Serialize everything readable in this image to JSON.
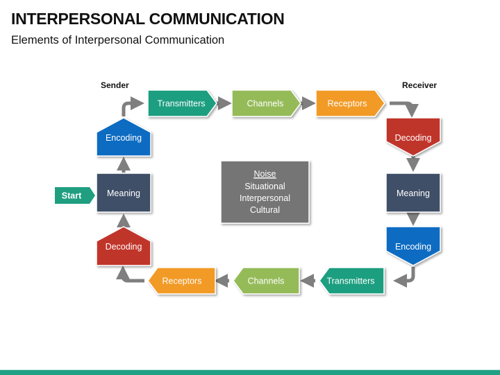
{
  "header": {
    "title": "INTERPERSONAL COMMUNICATION",
    "subtitle": "Elements of Interpersonal Communication"
  },
  "labels": {
    "sender": "Sender",
    "receiver": "Receiver"
  },
  "start": {
    "label": "Start",
    "color": "#1f9e80"
  },
  "sender_column": [
    {
      "label": "Encoding",
      "color": "#0a6cc2",
      "shape": "pentagon-up"
    },
    {
      "label": "Meaning",
      "color": "#3f5068",
      "shape": "rectangle"
    },
    {
      "label": "Decoding",
      "color": "#c0342c",
      "shape": "pentagon-up"
    }
  ],
  "top_row": [
    {
      "label": "Transmitters",
      "color": "#1f9e80",
      "shape": "arrow-right"
    },
    {
      "label": "Channels",
      "color": "#95bb58",
      "shape": "arrow-right"
    },
    {
      "label": "Receptors",
      "color": "#f29a25",
      "shape": "arrow-right"
    }
  ],
  "receiver_column": [
    {
      "label": "Decoding",
      "color": "#c0342c",
      "shape": "pentagon-down"
    },
    {
      "label": "Meaning",
      "color": "#3f5068",
      "shape": "rectangle"
    },
    {
      "label": "Encoding",
      "color": "#0a6cc2",
      "shape": "pentagon-down"
    }
  ],
  "bottom_row": [
    {
      "label": "Transmitters",
      "color": "#1f9e80",
      "shape": "arrow-left"
    },
    {
      "label": "Channels",
      "color": "#95bb58",
      "shape": "arrow-left"
    },
    {
      "label": "Receptors",
      "color": "#f29a25",
      "shape": "arrow-left"
    }
  ],
  "noise_box": {
    "heading": "Noise",
    "items": [
      "Situational",
      "Interpersonal",
      "Cultural"
    ],
    "color": "#747474"
  },
  "connector_color": "#7f7f7f",
  "footer_color": "#20a084"
}
